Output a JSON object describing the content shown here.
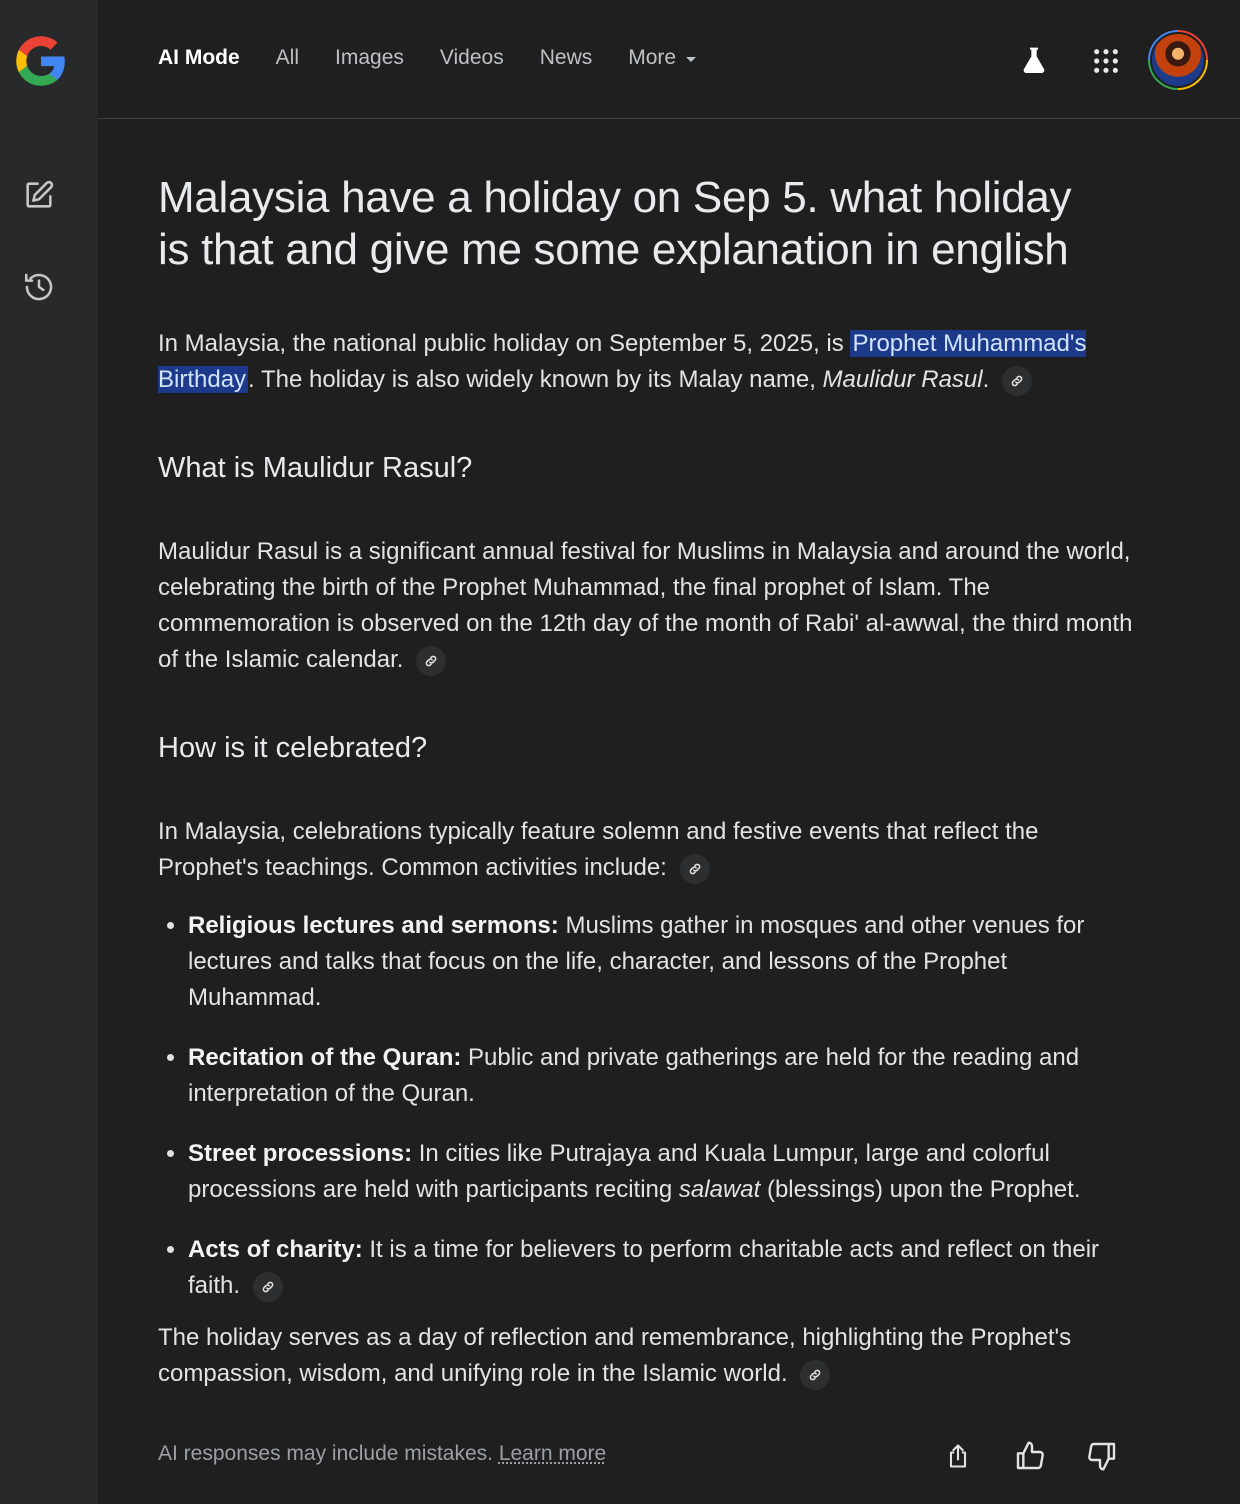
{
  "nav": {
    "tabs": [
      {
        "label": "AI Mode"
      },
      {
        "label": "All"
      },
      {
        "label": "Images"
      },
      {
        "label": "Videos"
      },
      {
        "label": "News"
      },
      {
        "label": "More"
      }
    ]
  },
  "sidebar": {
    "icons": [
      "new-chat-icon",
      "history-icon"
    ]
  },
  "query": "Malaysia have a holiday on Sep 5. what holiday is that and give me some explanation in english",
  "answer": {
    "intro_before": "In Malaysia, the national public holiday on September 5, 2025, is ",
    "intro_highlight": "Prophet Muhammad's Birthday",
    "intro_mid": ". The holiday is also widely known by its Malay name, ",
    "intro_italic": "Maulidur Rasul",
    "intro_end": ".",
    "section1_title": "What is Maulidur Rasul?",
    "section1_text": "Maulidur Rasul is a significant annual festival for Muslims in Malaysia and around the world, celebrating the birth of the Prophet Muhammad, the final prophet of Islam. The commemoration is observed on the 12th day of the month of Rabi' al-awwal, the third month of the Islamic calendar.",
    "section2_title": "How is it celebrated?",
    "section2_text": "In Malaysia, celebrations typically feature solemn and festive events that reflect the Prophet's teachings. Common activities include:",
    "bullets": [
      {
        "title": "Religious lectures and sermons:",
        "text": " Muslims gather in mosques and other venues for lectures and talks that focus on the life, character, and lessons of the Prophet Muhammad."
      },
      {
        "title": "Recitation of the Quran:",
        "text": " Public and private gatherings are held for the reading and interpretation of the Quran."
      },
      {
        "title": "Street processions:",
        "text_before": " In cities like Putrajaya and Kuala Lumpur, large and colorful processions are held with participants reciting ",
        "text_italic": "salawat",
        "text_after": " (blessings) upon the Prophet."
      },
      {
        "title": "Acts of charity:",
        "text": " It is a time for believers to perform charitable acts and reflect on their faith."
      }
    ],
    "closing": "The holiday serves as a day of reflection and remembrance, highlighting the Prophet's compassion, wisdom, and unifying role in the Islamic world."
  },
  "footer": {
    "disclaimer": "AI responses may include mistakes. ",
    "learn_more": "Learn more"
  },
  "colors": {
    "background": "#1f1f1f",
    "sidebar": "#28292a",
    "highlight": "#1d3a8a"
  }
}
